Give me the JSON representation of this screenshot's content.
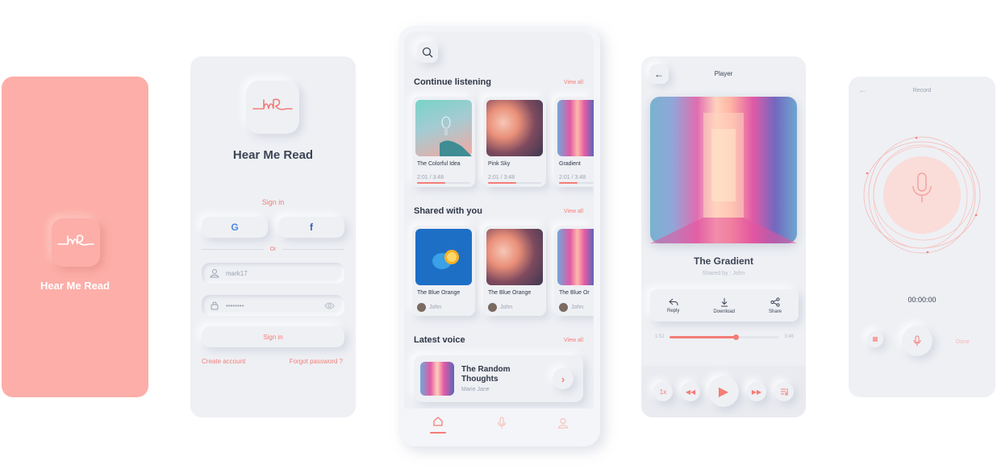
{
  "colors": {
    "accent": "#f47d77",
    "splash_bg": "#fdaea8",
    "surface": "#eef0f4",
    "text": "#3d4455",
    "muted": "#9aa1b0"
  },
  "splash": {
    "title": "Hear Me Read",
    "logo_icon": "hmr-logo-icon"
  },
  "login": {
    "title": "Hear Me Read",
    "sign_in_heading": "Sign in",
    "google_label": "G",
    "facebook_label": "f",
    "or_label": "Or",
    "username_value": "mark17",
    "password_value": "••••••••",
    "sign_in_button": "Sign in",
    "create_account": "Create account",
    "forgot_password": "Forgot password ?"
  },
  "home": {
    "continue": {
      "title": "Continue listening",
      "view_all": "View all",
      "items": [
        {
          "name": "The Colorful Idea",
          "time": "2:01 / 3:48",
          "progress": 0.53
        },
        {
          "name": "Pink Sky",
          "time": "2:01 / 3:48",
          "progress": 0.53
        },
        {
          "name": "Gradient",
          "time": "2:01 / 3:48",
          "progress": 0.53
        }
      ]
    },
    "shared": {
      "title": "Shared with you",
      "view_all": "View all",
      "items": [
        {
          "name": "The Blue Orange",
          "user": "John"
        },
        {
          "name": "The Blue Orange",
          "user": "John"
        },
        {
          "name": "The Blue Or",
          "user": "John"
        }
      ]
    },
    "latest": {
      "title": "Latest voice",
      "view_all": "View all",
      "item": {
        "title": "The Random Thoughts",
        "author": "Marie Jane"
      }
    },
    "tabs": [
      "home-icon",
      "mic-icon",
      "profile-icon"
    ]
  },
  "player": {
    "header": "Player",
    "song_title": "The Gradient",
    "shared_by": "Shared by : John",
    "actions": {
      "reply": "Reply",
      "download": "Download",
      "share": "Share"
    },
    "elapsed": "1:52",
    "total": "3:46",
    "progress": 0.6,
    "speed": "1x"
  },
  "record": {
    "header": "Record",
    "timer": "00:00:00",
    "done": "Done"
  }
}
